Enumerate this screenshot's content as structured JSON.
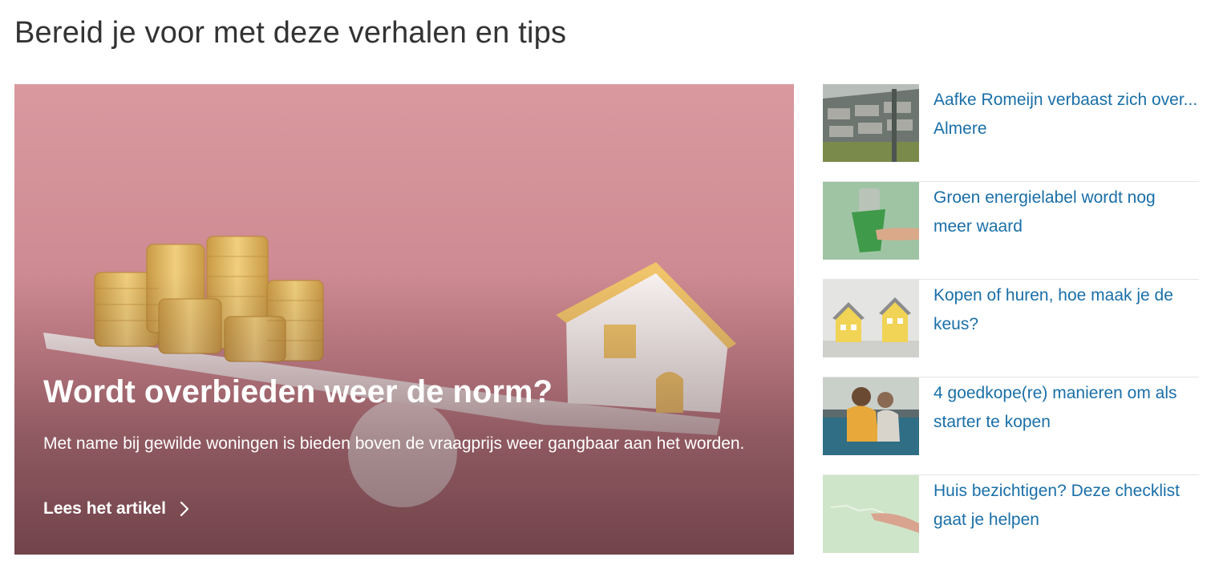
{
  "section": {
    "title": "Bereid je voor met deze verhalen en tips"
  },
  "featured": {
    "image_icon": "coins-house-seesaw-image",
    "title": "Wordt overbieden weer de norm?",
    "description": "Met name bij gewilde woningen is bieden boven de vraagprijs weer gangbaar aan het worden.",
    "link_label": "Lees het artikel",
    "colors": {
      "background": "#d4959e",
      "text": "#ffffff"
    }
  },
  "articles": [
    {
      "title": "Aafke Romeijn verbaast zich over... Almere",
      "image_icon": "aerial-neighborhood-image"
    },
    {
      "title": "Groen energielabel wordt nog meer waard",
      "image_icon": "green-cup-money-image"
    },
    {
      "title": "Kopen of huren, hoe maak je de keus?",
      "image_icon": "two-model-houses-image"
    },
    {
      "title": "4 goedkope(re) manieren om als starter te kopen",
      "image_icon": "people-on-couch-image"
    },
    {
      "title": "Huis bezichtigen? Deze checklist gaat je helpen",
      "image_icon": "finger-wall-crack-image"
    }
  ],
  "colors": {
    "link": "#1a6fa8",
    "heading": "#333333",
    "divider": "#e6e6e6"
  }
}
